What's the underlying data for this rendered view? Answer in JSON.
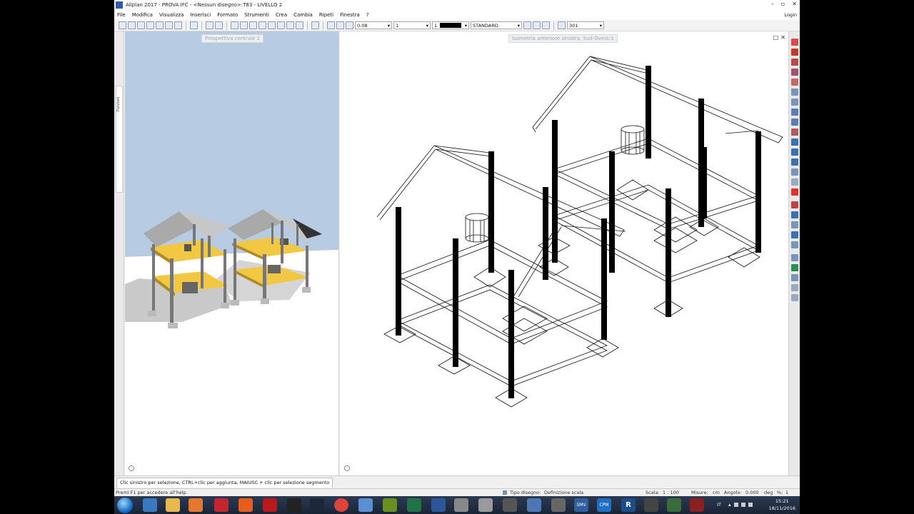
{
  "titlebar": {
    "title": "Allplan 2017 - PROVA IFC - <Nessun disegno>:T83 - LIVELLO 2"
  },
  "menu": {
    "items": [
      "File",
      "Modifica",
      "Visualizza",
      "Inserisci",
      "Formato",
      "Strumenti",
      "Crea",
      "Cambia",
      "Ripeti",
      "Finestra",
      "?"
    ]
  },
  "login_label": "Login",
  "toolbar": {
    "pen_value": "0.08",
    "line_value": "1",
    "color_value": "1",
    "layer_value": "STANDARD",
    "ruler_value": "301"
  },
  "left_tab_label": "Funzioni",
  "view_left": {
    "label": "Prospettiva centrale 2"
  },
  "view_right": {
    "label": "Isometria anteriore sinistra, Sud-Ovest:1"
  },
  "prompt": {
    "text": "Clic sinistro per selezione, CTRL+clic per aggiunta, MAIUSC + clic per selezione segmento"
  },
  "statusbar": {
    "help": "Premi F1 per accedere all'help.",
    "tipo_label": "Tipo disegno:",
    "tipo_value": "Definizione scala",
    "scala_label": "Scala:",
    "scala_value": "1 : 100",
    "misure_label": "Misure:",
    "misure_value": "cm",
    "angolo_label": "Angolo:",
    "angolo_value": "0.000",
    "angolo_unit": "deg",
    "percent_label": "%:",
    "percent_value": "1"
  },
  "taskbar": {
    "lang": "IT",
    "time": "15:21",
    "date": "18/11/2016",
    "apps": [
      "explorer-icon",
      "internet-explorer-icon",
      "file-manager-icon",
      "media-player-icon",
      "acrobat-icon",
      "office-icon",
      "acrobat-reader-icon",
      "blackberry-icon",
      "steam-icon",
      "chrome-icon",
      "network-icon",
      "puzzle-icon",
      "excel-icon",
      "word-icon",
      "paint-icon",
      "maps-icon",
      "allplan-icon",
      "nemetschek-icon",
      "bim-icon",
      "smv-icon",
      "cpm-icon",
      "revit-icon",
      "allplan-2-icon",
      "archicad-icon",
      "autocad-icon"
    ],
    "app_labels": {
      "smv": "SMV",
      "cpm": "CPM",
      "revit": "R"
    }
  }
}
